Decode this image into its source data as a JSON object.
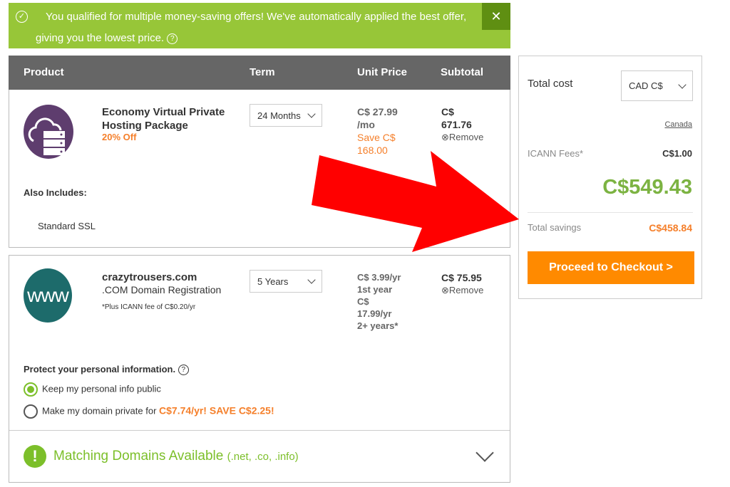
{
  "banner": {
    "line1": "You qualified for multiple money-saving offers! We've automatically applied the best offer,",
    "line2": "giving you the lowest price.",
    "close": "✕",
    "help": "?"
  },
  "table": {
    "headers": [
      "Product",
      "Term",
      "Unit Price",
      "Subtotal"
    ]
  },
  "items": [
    {
      "name_line1": "Economy Virtual Private",
      "name_line2": "Hosting Package",
      "discount": "20% Off",
      "term": "24 Months",
      "unit_price_1": "C$ 27.99",
      "unit_price_2": "/mo",
      "save_1": "Save C$",
      "save_2": "168.00",
      "subtotal_1": "C$",
      "subtotal_2": "671.76",
      "remove": "Remove",
      "includes_label": "Also Includes:",
      "includes": [
        "Standard SSL"
      ]
    },
    {
      "name": "crazytrousers.com",
      "desc": ".COM Domain Registration",
      "note": "*Plus ICANN fee of C$0.20/yr",
      "term": "5 Years",
      "unit_lines": [
        "C$ 3.99/yr",
        "1st year",
        "C$",
        "17.99/yr",
        "2+ years*"
      ],
      "subtotal": "C$ 75.95",
      "remove": "Remove",
      "logo_text": "www"
    }
  ],
  "privacy": {
    "title": "Protect your personal information.",
    "options": [
      {
        "label": "Keep my personal info public",
        "selected": true
      },
      {
        "label": "Make my domain private for",
        "highlight": "C$7.74/yr! SAVE C$2.25!",
        "selected": false
      }
    ]
  },
  "matching": {
    "title": "Matching Domains Available",
    "suffix": "(.net, .co, .info)",
    "icon": "!"
  },
  "summary": {
    "title": "Total cost",
    "currency": "CAD C$",
    "country": "Canada",
    "icann_label": "ICANN Fees*",
    "icann_value": "C$1.00",
    "total": "C$549.43",
    "savings_label": "Total savings",
    "savings_value": "C$458.84",
    "checkout": "Proceed to Checkout >"
  },
  "colors": {
    "green": "#97c638",
    "orange": "#ff8a00",
    "arrow": "#ff0000",
    "purple": "#5e3d6e",
    "teal": "#1d6b6b"
  }
}
